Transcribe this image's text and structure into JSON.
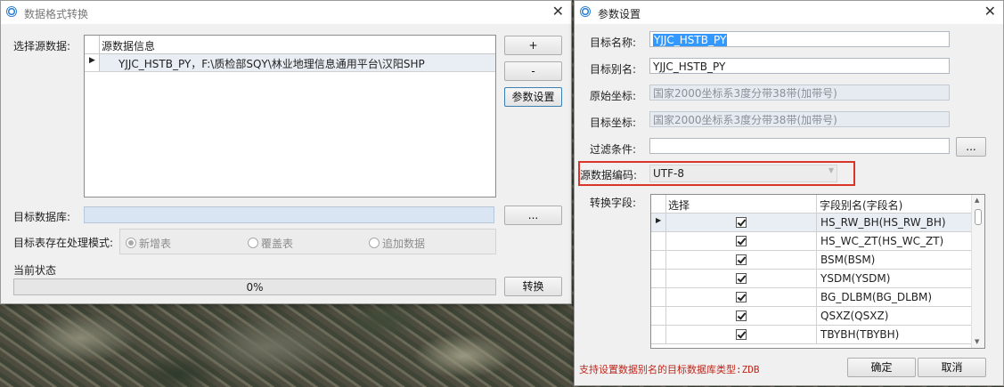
{
  "left_dialog": {
    "title": "数据格式转换",
    "select_source_label": "选择源数据:",
    "source_grid_header": "源数据信息",
    "source_rows": [
      "YJJC_HSTB_PY，F:\\质检部SQY\\林业地理信息通用平台\\汉阳SHP"
    ],
    "add_label": "+",
    "remove_label": "-",
    "param_settings_label": "参数设置",
    "target_db_label": "目标数据库:",
    "target_db_value": "",
    "browse_label": "...",
    "mode_label": "目标表存在处理模式:",
    "mode_options": [
      "新增表",
      "覆盖表",
      "追加数据"
    ],
    "status_label": "当前状态",
    "progress_text": "0%",
    "progress_value": 0,
    "convert_label": "转换"
  },
  "right_dialog": {
    "title": "参数设置",
    "target_name_label": "目标名称:",
    "target_name_value": "YJJC_HSTB_PY",
    "target_alias_label": "目标别名:",
    "target_alias_value": "YJJC_HSTB_PY",
    "source_coord_label": "原始坐标:",
    "source_coord_value": "国家2000坐标系3度分带38带(加带号)",
    "target_coord_label": "目标坐标:",
    "target_coord_value": "国家2000坐标系3度分带38带(加带号)",
    "filter_label": "过滤条件:",
    "filter_value": "",
    "filter_browse_label": "...",
    "encoding_label": "源数据编码:",
    "encoding_value": "UTF-8",
    "fields_label": "转换字段:",
    "fields_header_select": "选择",
    "fields_header_alias": "字段别名(字段名)",
    "fields": [
      {
        "alias": "HS_RW_BH(HS_RW_BH)",
        "checked": true
      },
      {
        "alias": "HS_WC_ZT(HS_WC_ZT)",
        "checked": true
      },
      {
        "alias": "BSM(BSM)",
        "checked": true
      },
      {
        "alias": "YSDM(YSDM)",
        "checked": true
      },
      {
        "alias": "BG_DLBM(BG_DLBM)",
        "checked": true
      },
      {
        "alias": "QSXZ(QSXZ)",
        "checked": true
      },
      {
        "alias": "TBYBH(TBYBH)",
        "checked": true
      }
    ],
    "note": "支持设置数据别名的目标数据库类型:ZDB",
    "ok_label": "确定",
    "cancel_label": "取消",
    "highlight_color": "#d9352b",
    "note_color": "#c0261b"
  }
}
